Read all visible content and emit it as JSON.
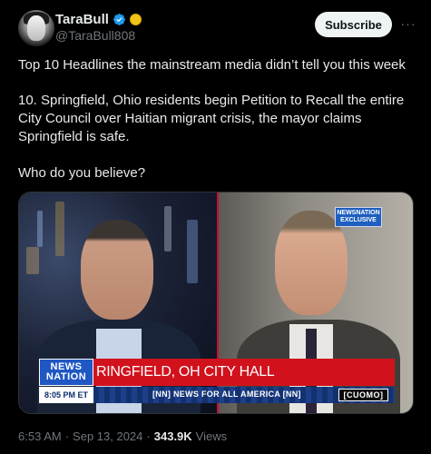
{
  "author": {
    "display_name": "TaraBull",
    "handle": "@TaraBull808",
    "avatar_icon": "profile-photo",
    "verified_icon": "verified-badge-icon",
    "affiliate_icon": "yellow-circle-badge-icon"
  },
  "actions": {
    "subscribe_label": "Subscribe",
    "more_label": "···"
  },
  "tweet": {
    "line1": "Top 10 Headlines the mainstream media didn’t tell you this week",
    "line2a": "10. Springfield, Ohio residents begin Petition to Recall the entire",
    "line2b": "City Council over Haitian migrant crisis, the mayor claims",
    "line2c": "Springfield is safe.",
    "line3": "Who do you believe?"
  },
  "media": {
    "network_logo_line1": "NEWSNATION",
    "network_logo_line2": "EXCLUSIVE",
    "chyron_logo_line1": "NEWS",
    "chyron_logo_line2": "NATION",
    "headline": "RINGFIELD, OH CITY HALL",
    "time": "8:05 PM ET",
    "ticker": "[NN] NEWS FOR ALL AMERICA [NN]",
    "show_name": "[CUOMO]",
    "colors": {
      "chyron_red": "#d1121d",
      "brand_blue": "#1f57c4"
    }
  },
  "meta": {
    "time": "6:53 AM",
    "separator1": "·",
    "date": "Sep 13, 2024",
    "separator2": "·",
    "views_count": "343.9K",
    "views_label": "Views"
  }
}
